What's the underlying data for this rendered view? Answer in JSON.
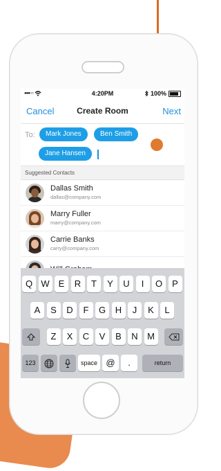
{
  "status_bar": {
    "carrier": "●●●○○",
    "time": "4:20PM",
    "battery_percent": "100%"
  },
  "nav": {
    "cancel_label": "Cancel",
    "title": "Create Room",
    "next_label": "Next"
  },
  "recipients": {
    "to_label": "To:",
    "chips": [
      "Mark Jones",
      "Ben Smith",
      "Jane Hansen"
    ]
  },
  "suggested": {
    "header": "Suggested Contacts",
    "contacts": [
      {
        "name": "Dallas Smith",
        "email": "dallas@company.com"
      },
      {
        "name": "Marry Fuller",
        "email": "marry@company.com"
      },
      {
        "name": "Carrie Banks",
        "email": "carry@company.com"
      },
      {
        "name": "Will Graham",
        "email": ""
      }
    ]
  },
  "keyboard": {
    "row1": [
      "Q",
      "W",
      "E",
      "R",
      "T",
      "Y",
      "U",
      "I",
      "O",
      "P"
    ],
    "row2": [
      "A",
      "S",
      "D",
      "F",
      "G",
      "H",
      "J",
      "K",
      "L"
    ],
    "row3": [
      "Z",
      "X",
      "C",
      "V",
      "B",
      "N",
      "M"
    ],
    "numbers_label": "123",
    "space_label": "space",
    "at_label": "@",
    "period_label": ".",
    "return_label": "return"
  },
  "colors": {
    "accent": "#1e9ee6",
    "annotation": "#e07a2e",
    "background_blob": "#e98a4e"
  }
}
